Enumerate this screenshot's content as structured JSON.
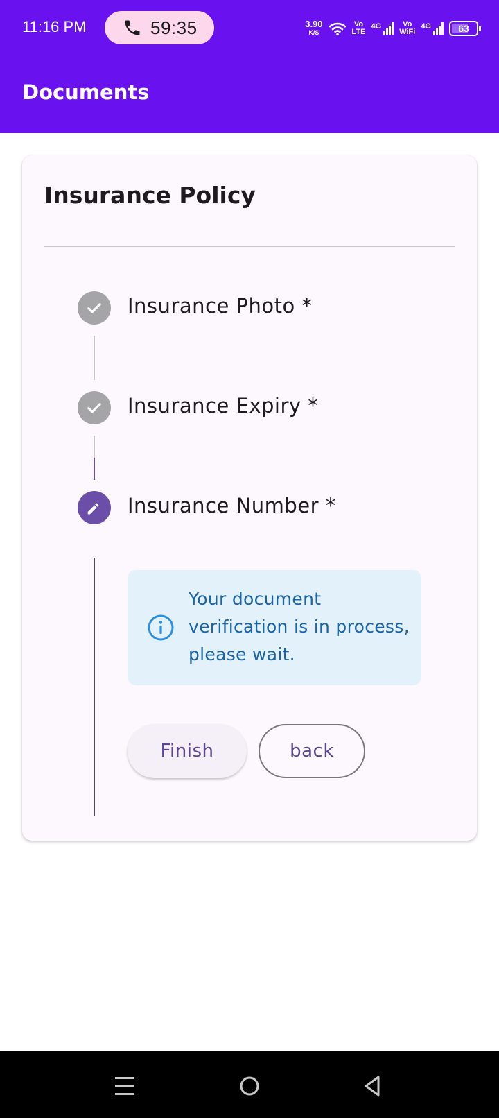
{
  "status_bar": {
    "time": "11:16 PM",
    "call_timer": "59:35",
    "net_speed_value": "3.90",
    "net_speed_unit": "K/S",
    "volte_top": "Vo",
    "volte_bottom": "LTE",
    "vowifi_top": "Vo",
    "vowifi_bottom": "WiFi",
    "net_type_1": "4G",
    "net_type_2": "4G",
    "battery_level": "63"
  },
  "app_bar": {
    "title": "Documents"
  },
  "card": {
    "title": "Insurance Policy",
    "steps": [
      {
        "label": "Insurance Photo *",
        "state": "done"
      },
      {
        "label": "Insurance Expiry *",
        "state": "done"
      },
      {
        "label": "Insurance Number *",
        "state": "active"
      }
    ],
    "info_message": "Your document verification is in process, please wait.",
    "finish_label": "Finish",
    "back_label": "back"
  },
  "colors": {
    "primary": "#6a11f0",
    "active_step": "#6a4ea8",
    "done_step": "#a5a4a6",
    "info_bg": "#e3f1fb",
    "info_text": "#1b64a8"
  }
}
